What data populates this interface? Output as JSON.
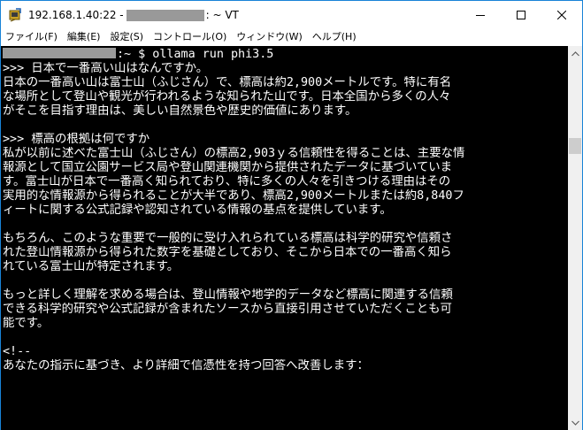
{
  "window": {
    "title_prefix": "192.168.1.40:22 - ",
    "title_suffix": ": ~ VT"
  },
  "menu": [
    {
      "label": "ファイル(F)"
    },
    {
      "label": "編集(E)"
    },
    {
      "label": "設定(S)"
    },
    {
      "label": "コントロール(O)"
    },
    {
      "label": "ウィンドウ(W)"
    },
    {
      "label": "ヘルプ(H)"
    }
  ],
  "terminal": {
    "prompt_suffix": ":~ $ ollama run phi3.5",
    "lines": [
      ">>> 日本で一番高い山はなんですか。",
      "日本の一番高い山は富士山（ふじさん）で、標高は約2,900メートルです。特に有名",
      "な場所として登山や観光が行われるような知られた山です。日本全国から多くの人々",
      "がそこを目指す理由は、美しい自然景色や歴史的価値にあります。",
      "",
      ">>> 標高の根拠は何ですか",
      "私が以前に述べた富士山（ふじさん）の標高2,903ｙる信頼性を得ることは、主要な情",
      "報源として国立公園サービス局や登山関連機関から提供されたデータに基づいていま",
      "す。富士山が日本で一番高く知られており、特に多くの人々を引きつける理由はその",
      "実用的な情報源から得られることが大半であり、標高2,900メートルまたは約8,840フ",
      "ィートに関する公式記録や認知されている情報の基点を提供しています。",
      "",
      "もちろん、このような重要で一般的に受け入れられている標高は科学的研究や信頼さ",
      "れた登山情報源から得られた数字を基礎としており、そこから日本での一番高く知ら",
      "れている富士山が特定されます。",
      "",
      "もっと詳しく理解を求める場合は、登山情報や地学的データなど標高に関連する信頼",
      "できる科学的研究や公式記録が含まれたソースから直接引用させていただくことも可",
      "能です。",
      "",
      "<!--",
      "あなたの指示に基づき、より詳細で信憑性を持つ回答へ改善します："
    ]
  },
  "colors": {
    "terminal_bg": "#000000",
    "terminal_fg": "#ffffff",
    "window_border": "#1883d7",
    "redaction": "#999999"
  }
}
